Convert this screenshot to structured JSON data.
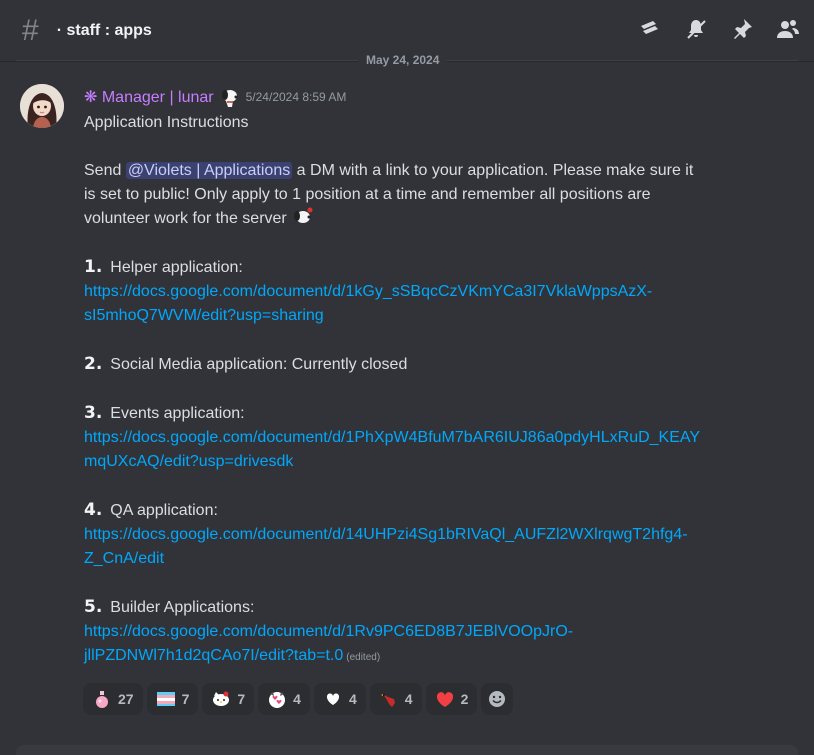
{
  "header": {
    "channel_prefix": "·",
    "channel_name": "staff : apps"
  },
  "date_divider": "May 24, 2024",
  "message": {
    "username": "❋ Manager | lunar",
    "timestamp": "5/24/2024 8:59 AM",
    "title": "Application Instructions",
    "body_before_mention": "Send ",
    "mention": "@Violets | Applications",
    "body_after_mention_1": " a DM with a link to your application. Please make sure it",
    "body_line_2": "is set to public! Only apply to 1 position at a time and remember all positions are",
    "body_line_3": "volunteer work for the server",
    "items": [
      {
        "num": "1.",
        "label": "Helper application:",
        "link_1": "https://docs.google.com/document/d/1kGy_sSBqcCzVKmYCa3I7VklaWppsAzX-",
        "link_2": "sI5mhoQ7WVM/edit?usp=sharing"
      },
      {
        "num": "2.",
        "label": "Social Media application: Currently closed"
      },
      {
        "num": "3.",
        "label": "Events application:",
        "link_1": "https://docs.google.com/document/d/1PhXpW4BfuM7bAR6IUJ86a0pdyHLxRuD_KEAY",
        "link_2": "mqUXcAQ/edit?usp=drivesdk"
      },
      {
        "num": "4.",
        "label": "QA application:",
        "link_1": "https://docs.google.com/document/d/14UHPzi4Sg1bRIVaQl_AUFZl2WXlrqwgT2hfg4-",
        "link_2": "Z_CnA/edit"
      },
      {
        "num": "5.",
        "label": "Builder Applications:",
        "link_1": "https://docs.google.com/document/d/1Rv9PC6ED8B7JEBlVOOpJrO-",
        "link_2": "jllPZDNWl7h1d2qCAo7I/edit?tab=t.0"
      }
    ],
    "edited_label": "(edited)"
  },
  "reactions": [
    {
      "icon": "potion-icon",
      "count": "27"
    },
    {
      "icon": "trans-flag-icon",
      "count": "7"
    },
    {
      "icon": "hello-kitty-icon",
      "count": "7"
    },
    {
      "icon": "cat-heart-icon",
      "count": "4"
    },
    {
      "icon": "white-heart-icon",
      "count": "4"
    },
    {
      "icon": "bird-icon",
      "count": "4"
    },
    {
      "icon": "red-heart-icon",
      "count": "2"
    }
  ],
  "colors": {
    "background": "#313338",
    "username": "#c77dff",
    "link": "#00a8fc",
    "mention_bg": "#3c4270",
    "reaction_bg": "#2b2d31"
  }
}
